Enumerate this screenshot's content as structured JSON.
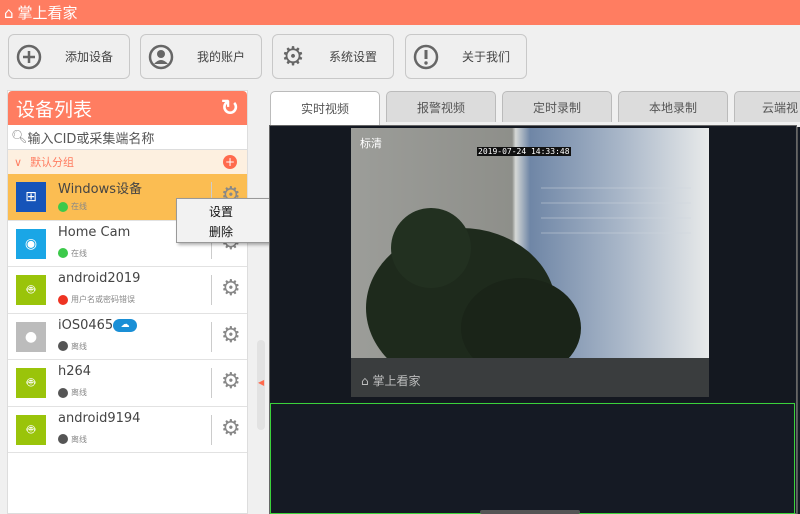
{
  "app": {
    "title": "掌上看家"
  },
  "toolbar": [
    {
      "label": "添加设备",
      "icon": "add-circle-icon"
    },
    {
      "label": "我的账户",
      "icon": "account-icon"
    },
    {
      "label": "系统设置",
      "icon": "gear-icon"
    },
    {
      "label": "关于我们",
      "icon": "info-icon"
    }
  ],
  "sidebar": {
    "title": "设备列表",
    "search_placeholder": "输入CID或采集端名称",
    "group": "默认分组",
    "devices": [
      {
        "name": "Windows设备",
        "status": "在线",
        "color": "#1654b9"
      },
      {
        "name": "Home Cam",
        "status": "在线",
        "color": "#1aa6e6"
      },
      {
        "name": "android2019",
        "status": "用户名或密码错误",
        "color": "#9ac40a"
      },
      {
        "name": "iOS0465",
        "status": "离线",
        "color": "#bcbcbc"
      },
      {
        "name": "h264",
        "status": "离线",
        "color": "#9ac40a"
      },
      {
        "name": "android9194",
        "status": "离线",
        "color": "#9ac40a"
      }
    ]
  },
  "context_menu": [
    "设置",
    "删除"
  ],
  "tabs": [
    "实时视频",
    "报警视频",
    "定时录制",
    "本地录制",
    "云端视"
  ],
  "video": {
    "quality": "标清",
    "timestamp": "2019-07-24 14:33:48",
    "watermark": "掌上看家"
  }
}
